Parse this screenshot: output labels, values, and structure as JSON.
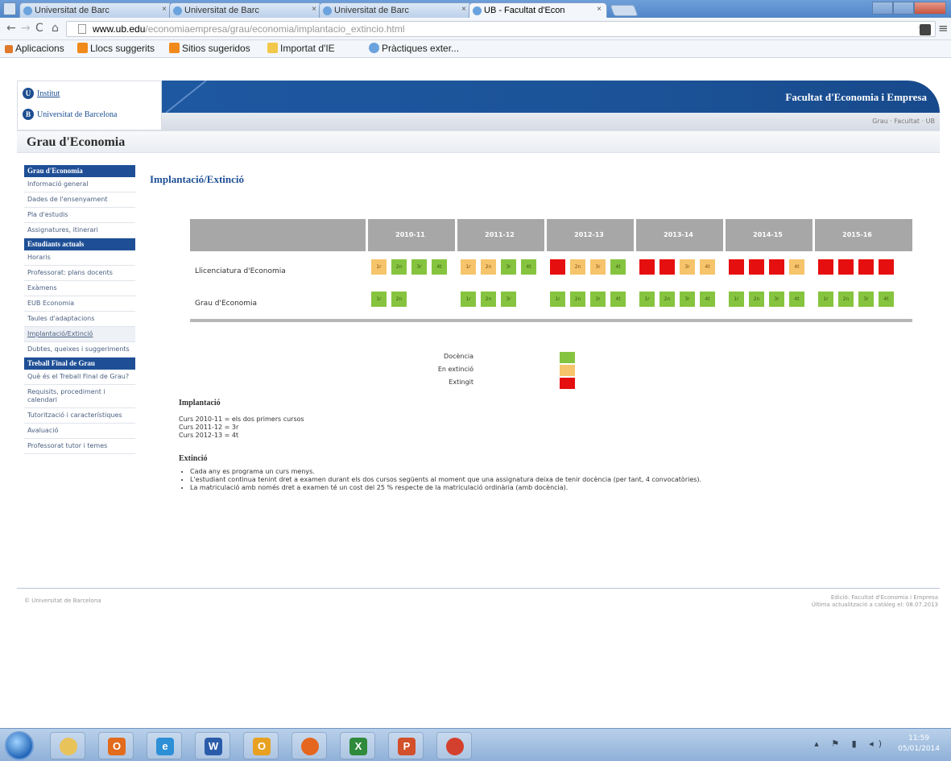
{
  "browser": {
    "tabs": [
      {
        "label": "Universitat de Barc",
        "active": false
      },
      {
        "label": "Universitat de Barc",
        "active": false
      },
      {
        "label": "Universitat de Barc",
        "active": false
      },
      {
        "label": "UB - Facultat d'Econ",
        "active": true
      }
    ],
    "url_host": "www.ub.edu",
    "url_path": "/economiaempresa/grau/economia/implantacio_extincio.html",
    "bookmarks": [
      {
        "label": "Aplicacions",
        "color": "#e07a2a"
      },
      {
        "label": "Llocs suggerits",
        "color": "#f08a1a"
      },
      {
        "label": "Sitios sugeridos",
        "color": "#f08a1a"
      },
      {
        "label": "Importat d'IE",
        "color": "#f2c84a"
      },
      {
        "label": "Pràctiques exter...",
        "color": "#6aa3de"
      }
    ]
  },
  "site": {
    "logo_line1": "Institut",
    "logo_line2": "Universitat de Barcelona",
    "banner_title": "Facultat d'Economia i Empresa",
    "subbar_links": "Grau · Facultat · UB",
    "page_title": "Grau d'Economia"
  },
  "sidebar": {
    "sections": [
      {
        "heading": "Grau d'Economia",
        "items": [
          "Informació general",
          "Dades de l'ensenyament",
          "Pla d'estudis",
          "Assignatures, itinerari"
        ]
      },
      {
        "heading": "Estudiants actuals",
        "items": [
          "Horaris",
          "Professorat: plans docents",
          "Exàmens",
          "EUB Economia",
          "Taules d'adaptacions",
          "Implantació/Extinció",
          "Dubtes, queixes i suggeriments"
        ]
      },
      {
        "heading": "Treball Final de Grau",
        "items": [
          "Què és el Treball Final de Grau?",
          "Requisits, procediment i calendari",
          "Tutorització i característiques",
          "Avaluació",
          "Professorat tutor i temes"
        ]
      }
    ],
    "current": "Implantació/Extinció"
  },
  "content": {
    "title": "Implantació/Extinció",
    "years": [
      "2010-11",
      "2011-12",
      "2012-13",
      "2013-14",
      "2014-15",
      "2015-16"
    ],
    "rows": [
      {
        "label": "Llicenciatura d'Economia",
        "cells": [
          [
            {
              "t": "1r",
              "s": "ext"
            },
            {
              "t": "2n",
              "s": "doc"
            },
            {
              "t": "3r",
              "s": "doc"
            },
            {
              "t": "4t",
              "s": "doc"
            }
          ],
          [
            {
              "t": "1r",
              "s": "ext"
            },
            {
              "t": "2n",
              "s": "ext"
            },
            {
              "t": "3r",
              "s": "doc"
            },
            {
              "t": "4t",
              "s": "doc"
            }
          ],
          [
            {
              "t": "",
              "s": "exg"
            },
            {
              "t": "2n",
              "s": "ext"
            },
            {
              "t": "3r",
              "s": "ext"
            },
            {
              "t": "4t",
              "s": "doc"
            }
          ],
          [
            {
              "t": "",
              "s": "exg"
            },
            {
              "t": "",
              "s": "exg"
            },
            {
              "t": "3r",
              "s": "ext"
            },
            {
              "t": "4t",
              "s": "ext"
            }
          ],
          [
            {
              "t": "",
              "s": "exg"
            },
            {
              "t": "",
              "s": "exg"
            },
            {
              "t": "",
              "s": "exg"
            },
            {
              "t": "4t",
              "s": "ext"
            }
          ],
          [
            {
              "t": "",
              "s": "exg"
            },
            {
              "t": "",
              "s": "exg"
            },
            {
              "t": "",
              "s": "exg"
            },
            {
              "t": "",
              "s": "exg"
            }
          ]
        ]
      },
      {
        "label": "Grau d'Economia",
        "cells": [
          [
            {
              "t": "1r",
              "s": "doc"
            },
            {
              "t": "2n",
              "s": "doc"
            }
          ],
          [
            {
              "t": "1r",
              "s": "doc"
            },
            {
              "t": "2n",
              "s": "doc"
            },
            {
              "t": "3r",
              "s": "doc"
            }
          ],
          [
            {
              "t": "1r",
              "s": "doc"
            },
            {
              "t": "2n",
              "s": "doc"
            },
            {
              "t": "3r",
              "s": "doc"
            },
            {
              "t": "4t",
              "s": "doc"
            }
          ],
          [
            {
              "t": "1r",
              "s": "doc"
            },
            {
              "t": "2n",
              "s": "doc"
            },
            {
              "t": "3r",
              "s": "doc"
            },
            {
              "t": "4t",
              "s": "doc"
            }
          ],
          [
            {
              "t": "1r",
              "s": "doc"
            },
            {
              "t": "2n",
              "s": "doc"
            },
            {
              "t": "3r",
              "s": "doc"
            },
            {
              "t": "4t",
              "s": "doc"
            }
          ],
          [
            {
              "t": "1r",
              "s": "doc"
            },
            {
              "t": "2n",
              "s": "doc"
            },
            {
              "t": "3r",
              "s": "doc"
            },
            {
              "t": "4t",
              "s": "doc"
            }
          ]
        ]
      }
    ],
    "legend": [
      {
        "label": "Docència",
        "color": "#86c440"
      },
      {
        "label": "En extinció",
        "color": "#f6c46b"
      },
      {
        "label": "Extingit",
        "color": "#e60f0f"
      }
    ],
    "implantacio": {
      "heading": "Implantació",
      "lines": [
        "Curs 2010-11 = els dos primers cursos",
        "Curs 2011-12 = 3r",
        "Curs 2012-13 = 4t"
      ]
    },
    "extincio": {
      "heading": "Extinció",
      "items": [
        "Cada any es programa un curs menys.",
        "L'estudiant continua tenint dret a examen durant els dos cursos següents al moment que una assignatura deixa de tenir docència (per tant, 4 convocatòries).",
        "La matriculació amb només dret a examen té un cost del 25 % respecte de la matriculació ordinària (amb docència)."
      ]
    }
  },
  "footer": {
    "left": "© Universitat de Barcelona",
    "right_1": "Edició: Facultat d'Economia i Empresa",
    "right_2": "Última actualització a catàleg el: 08.07.2013"
  },
  "taskbar": {
    "apps": [
      {
        "name": "explorer-icon",
        "glyph": "",
        "color": "#e8c35a"
      },
      {
        "name": "outlook-icon",
        "glyph": "O",
        "color": "#e26b1c"
      },
      {
        "name": "internet-explorer-icon",
        "glyph": "e",
        "color": "#2d8fd6"
      },
      {
        "name": "word-icon",
        "glyph": "W",
        "color": "#2b5caa"
      },
      {
        "name": "outlook2-icon",
        "glyph": "O",
        "color": "#e8a020"
      },
      {
        "name": "firefox-icon",
        "glyph": "",
        "color": "#e5661e"
      },
      {
        "name": "excel-icon",
        "glyph": "X",
        "color": "#2f8a3b"
      },
      {
        "name": "powerpoint-icon",
        "glyph": "P",
        "color": "#d2502a"
      },
      {
        "name": "chrome-icon",
        "glyph": "",
        "color": "#d4402e"
      }
    ],
    "time": "11:59",
    "date": "05/01/2014"
  }
}
